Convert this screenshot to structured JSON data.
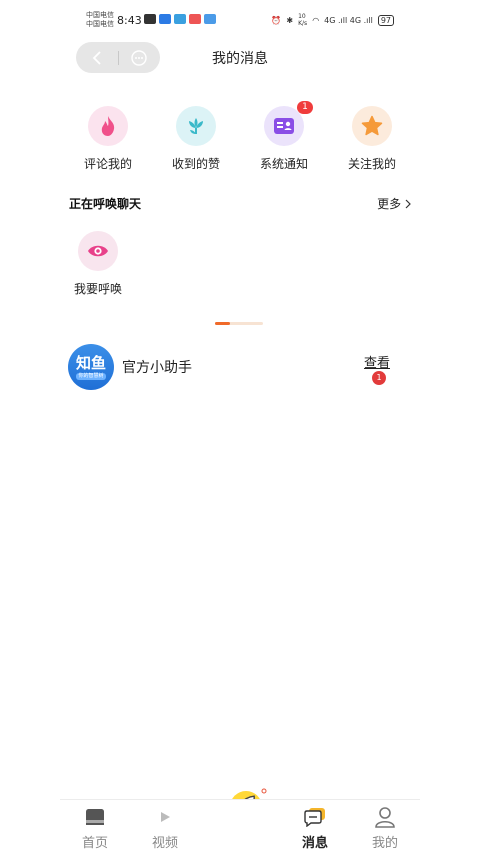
{
  "status_bar": {
    "carrier_line1": "中国电信",
    "carrier_line2": "中国电信",
    "time": "8:43",
    "network_speed_value": "10",
    "network_speed_unit": "K/s",
    "signal_text": "4G .ıll 4G .ıll",
    "battery": "97"
  },
  "header": {
    "title": "我的消息",
    "back_icon": "chevron-left-icon",
    "more_icon": "dots-circle-icon"
  },
  "categories": [
    {
      "label": "评论我的",
      "icon": "flame-icon",
      "bg": "#fbe3ee",
      "color": "#f0508a",
      "badge": ""
    },
    {
      "label": "收到的赞",
      "icon": "flower-icon",
      "bg": "#dcf3f6",
      "color": "#3ab9c9",
      "badge": ""
    },
    {
      "label": "系统通知",
      "icon": "id-card-icon",
      "bg": "#ebe3fb",
      "color": "#8a4ee6",
      "badge": "1"
    },
    {
      "label": "关注我的",
      "icon": "star-icon",
      "bg": "#fcebdc",
      "color": "#f59a3a",
      "badge": ""
    }
  ],
  "section": {
    "title": "正在呼唤聊天",
    "more": "更多"
  },
  "summon": {
    "label": "我要呼唤",
    "icon": "eye-icon"
  },
  "assistant": {
    "avatar_text": "知鱼",
    "avatar_sub": "你的智慧树",
    "name": "官方小助手",
    "view": "查看",
    "badge": "1"
  },
  "tabbar": {
    "tabs": [
      {
        "label": "首页",
        "icon": "home-icon",
        "active": false
      },
      {
        "label": "视频",
        "icon": "play-icon",
        "active": false
      },
      {
        "label": "消息",
        "icon": "chat-icon",
        "active": true
      },
      {
        "label": "我的",
        "icon": "user-icon",
        "active": false
      }
    ],
    "center_icon": "rocket-icon"
  },
  "colors": {
    "accent": "#f06a2a",
    "badge": "#f03c3c",
    "avatar_blue": "#2a7fe0"
  }
}
